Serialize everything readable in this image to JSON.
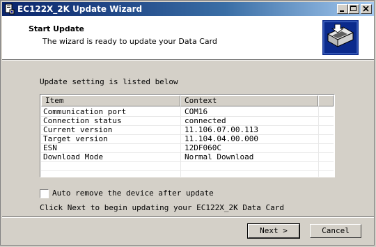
{
  "window": {
    "title": "EC122X_2K Update Wizard",
    "controls": [
      "minimize-icon",
      "maximize-icon",
      "close-icon"
    ]
  },
  "header": {
    "title": "Start Update",
    "subtitle": "The wizard is ready to update your Data Card"
  },
  "main": {
    "section_label": "Update setting is listed below",
    "table": {
      "columns": [
        "Item",
        "Context"
      ],
      "rows": [
        {
          "item": "Communication port",
          "context": "COM16"
        },
        {
          "item": "Connection status",
          "context": "connected"
        },
        {
          "item": "Current version",
          "context": "11.106.07.00.113"
        },
        {
          "item": "Target version",
          "context": "11.104.04.00.000"
        },
        {
          "item": "ESN",
          "context": "12DF060C"
        },
        {
          "item": "Download Mode",
          "context": "Normal Download"
        }
      ]
    },
    "auto_remove": {
      "label": "Auto remove the device after update",
      "checked": false
    },
    "hint": "Click Next to begin updating your EC122X_2K Data Card"
  },
  "footer": {
    "next_label": "Next >",
    "cancel_label": "Cancel"
  },
  "colors": {
    "title_bar_start": "#0a246a",
    "title_bar_end": "#a6caf0",
    "dialog_face": "#d4d0c8",
    "header_graphic": "#0b2a8c"
  }
}
